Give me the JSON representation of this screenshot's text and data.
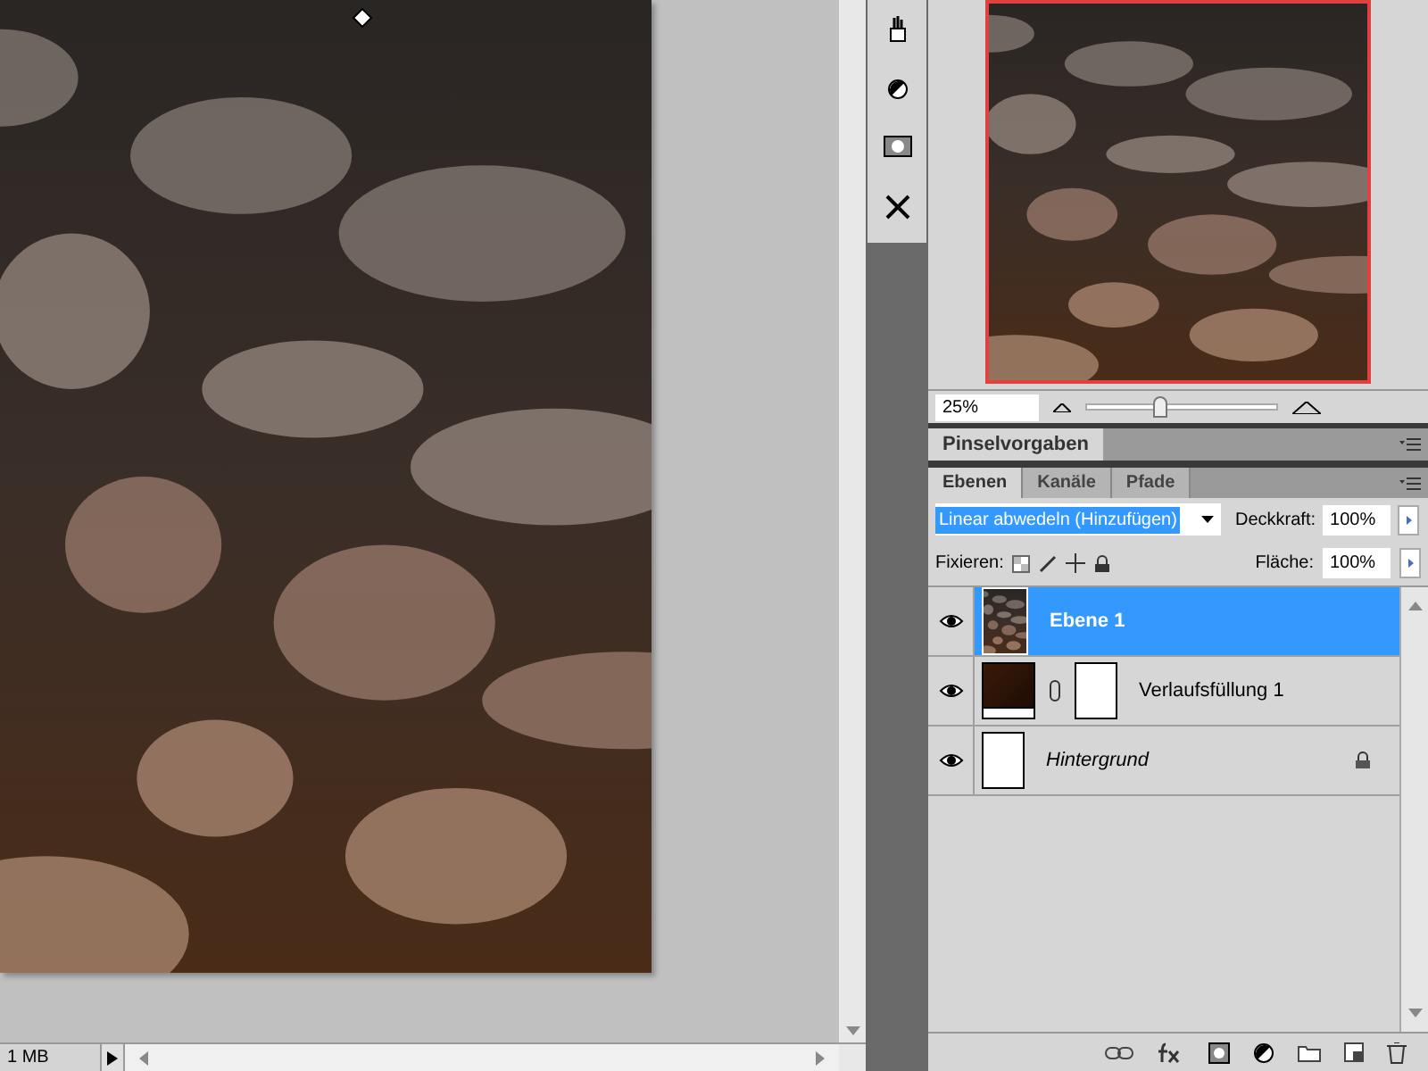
{
  "document": {
    "status": "1 MB"
  },
  "navigator": {
    "zoom": "25%",
    "level": 0.39
  },
  "brush_panel": {
    "tabs": [
      {
        "label": "Pinselvorgaben",
        "selected": true
      }
    ]
  },
  "layers_panel": {
    "tabs": [
      {
        "label": "Ebenen",
        "selected": true
      },
      {
        "label": "Kanäle",
        "selected": false
      },
      {
        "label": "Pfade",
        "selected": false
      }
    ],
    "blend_mode": "Linear abwedeln (Hinzufügen)",
    "opacity_label": "Deckkraft:",
    "opacity": "100%",
    "lock_label": "Fixieren:",
    "fill_label": "Fläche:",
    "fill": "100%",
    "layers": [
      {
        "name": "Ebene 1",
        "kind": "pixel",
        "visible": true,
        "selected": true,
        "locked": false
      },
      {
        "name": "Verlaufsfüllung 1",
        "kind": "fill",
        "visible": true,
        "selected": false,
        "locked": false
      },
      {
        "name": "Hintergrund",
        "kind": "background",
        "visible": true,
        "selected": false,
        "locked": true
      }
    ]
  }
}
